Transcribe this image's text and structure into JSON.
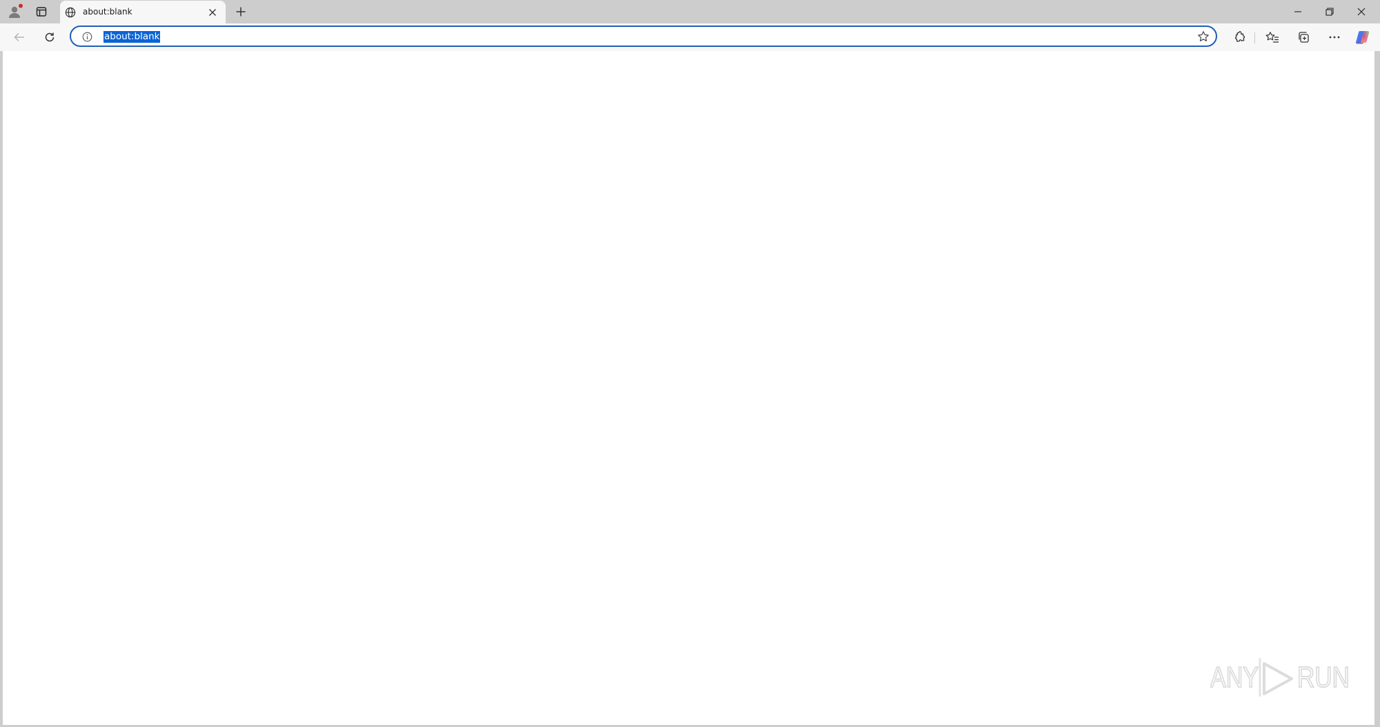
{
  "browser": {
    "tab": {
      "title": "about:blank",
      "favicon": "globe-icon",
      "close_icon": "close-icon"
    },
    "new_tab_icon": "plus-icon",
    "address_bar": {
      "value": "about:blank",
      "selected": true,
      "info_icon": "info-icon",
      "favorite_icon": "star-icon"
    },
    "nav": {
      "back_icon": "back-arrow-icon",
      "refresh_icon": "refresh-icon"
    },
    "toolbar_icons": [
      "extensions-icon",
      "favorites-icon",
      "collections-icon",
      "more-icon",
      "copilot-icon"
    ],
    "window_controls": [
      "minimize-icon",
      "restore-icon",
      "close-icon"
    ]
  },
  "watermark": {
    "text": "ANY RUN"
  },
  "colors": {
    "titlebar": "#cdcdcd",
    "toolbar": "#f7f7f7",
    "focus_ring": "#1f5eb6",
    "selection": "#0a64d6"
  }
}
